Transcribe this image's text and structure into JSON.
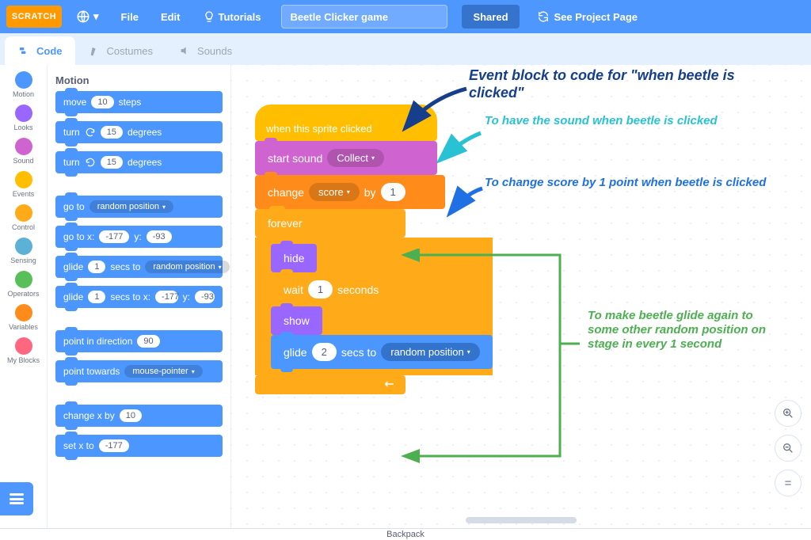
{
  "menubar": {
    "logo_text": "SCRATCH",
    "file": "File",
    "edit": "Edit",
    "tutorials": "Tutorials",
    "project_title": "Beetle Clicker game",
    "shared": "Shared",
    "see_project": "See Project Page"
  },
  "tabs": {
    "code": "Code",
    "costumes": "Costumes",
    "sounds": "Sounds"
  },
  "categories": [
    {
      "name": "Motion",
      "dot": "dot-motion"
    },
    {
      "name": "Looks",
      "dot": "dot-looks"
    },
    {
      "name": "Sound",
      "dot": "dot-sound"
    },
    {
      "name": "Events",
      "dot": "dot-events"
    },
    {
      "name": "Control",
      "dot": "dot-control"
    },
    {
      "name": "Sensing",
      "dot": "dot-sensing"
    },
    {
      "name": "Operators",
      "dot": "dot-operators"
    },
    {
      "name": "Variables",
      "dot": "dot-variables"
    },
    {
      "name": "My Blocks",
      "dot": "dot-myblocks"
    }
  ],
  "palette": {
    "header": "Motion",
    "move_steps": {
      "label_pre": "move",
      "val": "10",
      "label_post": "steps"
    },
    "turn_cw": {
      "label_pre": "turn",
      "val": "15",
      "label_post": "degrees"
    },
    "turn_ccw": {
      "label_pre": "turn",
      "val": "15",
      "label_post": "degrees"
    },
    "goto_random": {
      "label": "go to",
      "option": "random position"
    },
    "goto_xy": {
      "label": "go to x:",
      "x": "-177",
      "mid": "y:",
      "y": "-93"
    },
    "glide_random": {
      "pre": "glide",
      "secs": "1",
      "mid": "secs to",
      "option": "random position"
    },
    "glide_xy": {
      "pre": "glide",
      "secs": "1",
      "mid": "secs to x:",
      "x": "-177",
      "mid2": "y:",
      "y": "-93"
    },
    "point_dir": {
      "label": "point in direction",
      "val": "90"
    },
    "point_towards": {
      "label": "point towards",
      "option": "mouse-pointer"
    },
    "change_x": {
      "label": "change x by",
      "val": "10"
    },
    "set_x": {
      "label": "set x to",
      "val": "-177"
    }
  },
  "script": {
    "hat": "when this sprite clicked",
    "start_sound": {
      "label": "start sound",
      "option": "Collect"
    },
    "change_var": {
      "label": "change",
      "option": "score",
      "mid": "by",
      "val": "1"
    },
    "forever": "forever",
    "hide": "hide",
    "wait": {
      "pre": "wait",
      "val": "1",
      "post": "seconds"
    },
    "show": "show",
    "glide": {
      "pre": "glide",
      "val": "2",
      "mid": "secs to",
      "option": "random position"
    }
  },
  "annotations": {
    "a1": "Event block to code for \"when beetle is clicked\"",
    "a2": "To have the sound when beetle is clicked",
    "a3": "To change score by 1 point when beetle is clicked",
    "a4": "To make beetle glide again to some other random position on stage in every 1 second"
  },
  "backpack": "Backpack"
}
